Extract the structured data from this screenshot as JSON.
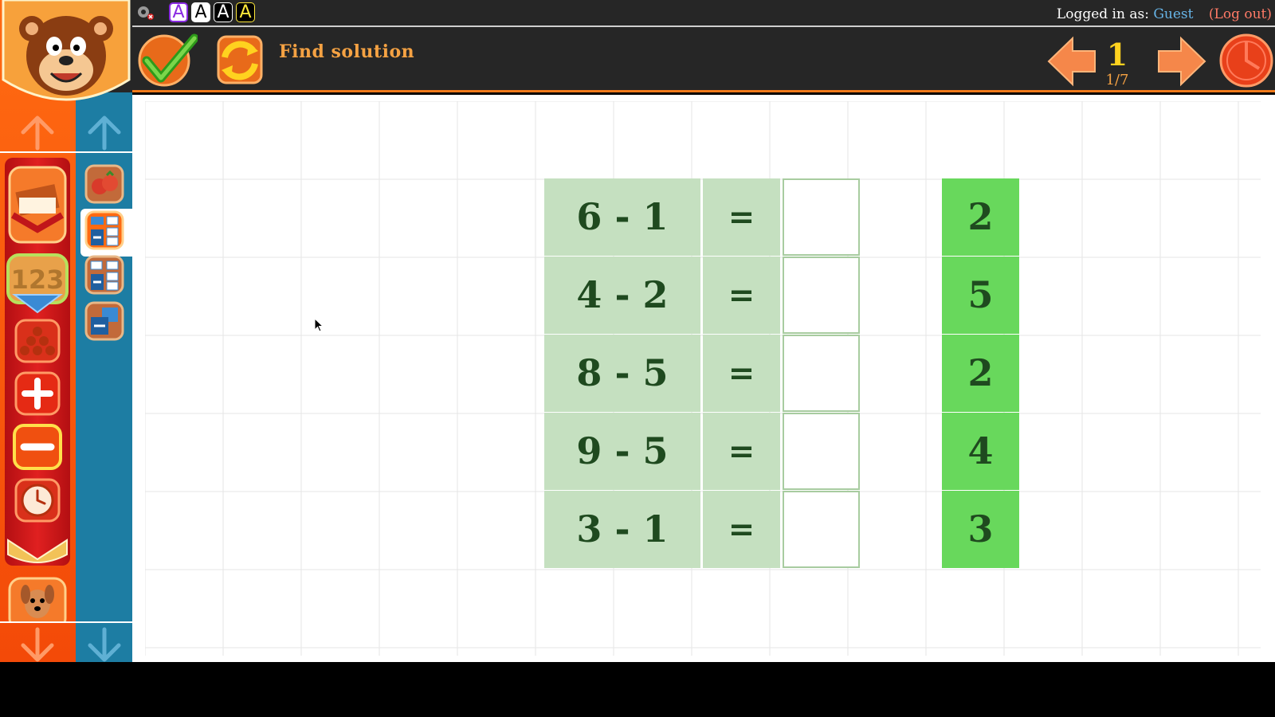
{
  "topbar": {
    "font_options": [
      "A",
      "A",
      "A",
      "A"
    ],
    "login_prefix": "Logged in as:",
    "login_user": "Guest",
    "logout_label": "(Log out)"
  },
  "toolbar": {
    "task_title": "Find solution",
    "page_current": "1",
    "page_total": "1/7"
  },
  "grid": {
    "rows": [
      {
        "expression": "6 - 1",
        "equals": "=",
        "answer": ""
      },
      {
        "expression": "4 - 2",
        "equals": "=",
        "answer": ""
      },
      {
        "expression": "8 - 5",
        "equals": "=",
        "answer": ""
      },
      {
        "expression": "9 - 5",
        "equals": "=",
        "answer": ""
      },
      {
        "expression": "3 - 1",
        "equals": "=",
        "answer": ""
      }
    ],
    "options": [
      "2",
      "5",
      "2",
      "4",
      "3"
    ]
  },
  "sidebar": {
    "category_icons": [
      "book-icon",
      "numbers-123-icon",
      "counting-balls-icon",
      "plus-icon",
      "minus-icon",
      "clock-icon",
      "dog-icon"
    ],
    "sub_icons": [
      "tomatoes-icon",
      "subtraction-table-icon",
      "subtraction-grid-icon",
      "subtraction-box-icon"
    ]
  },
  "colors": {
    "accent_orange": "#f27a1a",
    "toolbar_bg": "#262626",
    "expression_cell": "#c5e0c0",
    "option_cell": "#68d85c",
    "sidebar_blue": "#1d7da3"
  }
}
